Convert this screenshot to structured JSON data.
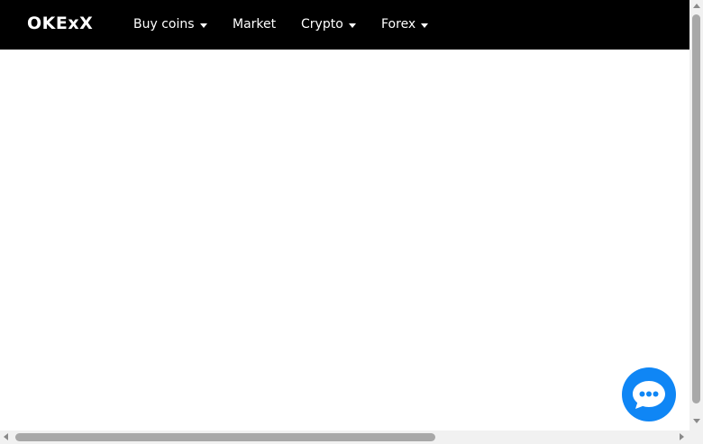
{
  "brand": {
    "logo_text": "OKExX"
  },
  "nav": {
    "items": [
      {
        "label": "Buy coins",
        "has_dropdown": true
      },
      {
        "label": "Market",
        "has_dropdown": false
      },
      {
        "label": "Crypto",
        "has_dropdown": true
      },
      {
        "label": "Forex",
        "has_dropdown": true
      }
    ]
  },
  "chat": {
    "icon": "chat-bubble-icon",
    "color": "#0f86f5"
  },
  "colors": {
    "navbar_bg": "#000000",
    "page_bg": "#ffffff",
    "accent": "#0f86f5"
  }
}
